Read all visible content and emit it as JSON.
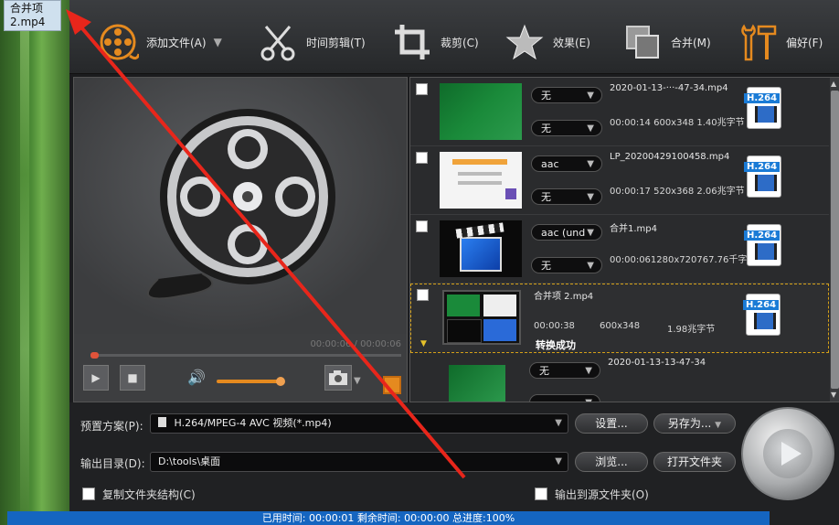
{
  "desktop": {
    "file_label_line1": "合并项",
    "file_label_line2": "2.mp4"
  },
  "toolbar": {
    "add_file": "添加文件(A)",
    "trim": "时间剪辑(T)",
    "crop": "裁剪(C)",
    "effects": "效果(E)",
    "merge": "合并(M)",
    "prefs": "偏好(F)"
  },
  "preview": {
    "time": "00:00:06 / 00:00:06"
  },
  "files": [
    {
      "name": "2020-01-13-···-47-34.mp4",
      "info": "00:00:14 600x348  1.40兆字节",
      "audio": "无",
      "subtitle": "无",
      "codec": "H.264"
    },
    {
      "name": "LP_20200429100458.mp4",
      "info": "00:00:17 520x368  2.06兆字节",
      "audio": "aac",
      "subtitle": "无",
      "codec": "H.264"
    },
    {
      "name": "合并1.mp4",
      "info": "00:00:061280x720767.76千字",
      "audio": "aac (und",
      "subtitle": "无",
      "codec": "H.264"
    },
    {
      "name": "合并项 2.mp4",
      "duration": "00:00:38",
      "resolution": "600x348",
      "size": "1.98兆字节",
      "status": "转换成功",
      "codec": "H.264"
    },
    {
      "name": "2020-01-13-13-47-34",
      "audio": "无"
    }
  ],
  "bottom": {
    "preset_label": "预置方案(P):",
    "preset_value": "H.264/MPEG-4 AVC 视频(*.mp4)",
    "settings_btn": "设置...",
    "saveas_btn": "另存为...",
    "output_label": "输出目录(D):",
    "output_value": "D:\\tools\\桌面",
    "browse_btn": "浏览...",
    "open_folder_btn": "打开文件夹",
    "copy_structure": "复制文件夹结构(C)",
    "output_to_source": "输出到源文件夹(O)"
  },
  "status_bar": "已用时间: 00:00:01 剩余时间: 00:00:00 总进度:100%",
  "colors": {
    "accent": "#e58a1f",
    "status_blue": "#1565c0",
    "annotation_red": "#e8261b"
  }
}
